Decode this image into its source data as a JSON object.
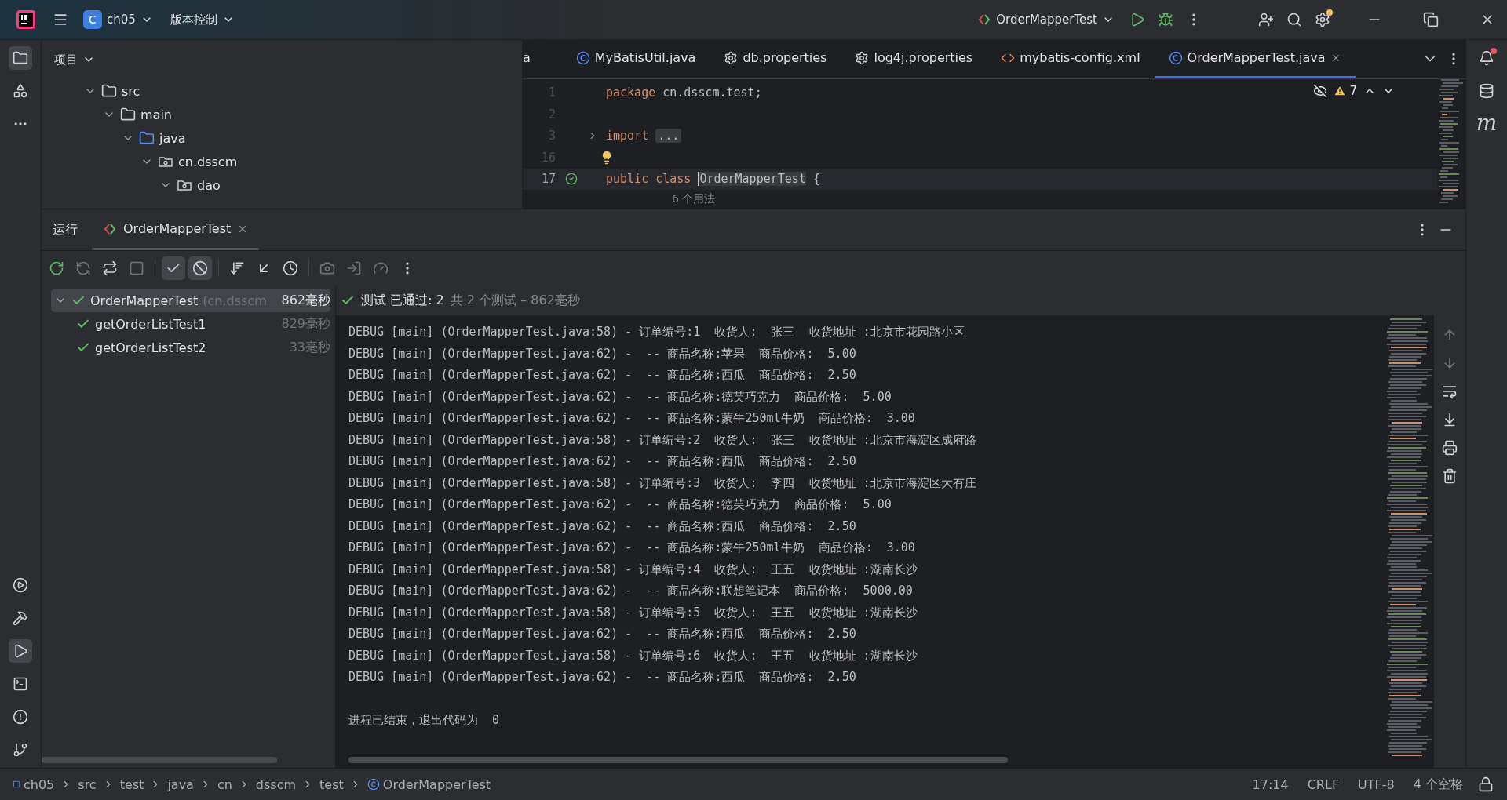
{
  "title_bar": {
    "project": "ch05",
    "project_badge": "C",
    "vcs": "版本控制",
    "run_config": "OrderMapperTest",
    "settings_badge": true
  },
  "project_panel": {
    "title": "项目",
    "tree": [
      {
        "label": "src",
        "kind": "folder",
        "expanded": true,
        "children": [
          {
            "label": "main",
            "kind": "folder",
            "expanded": true,
            "children": [
              {
                "label": "java",
                "kind": "source",
                "expanded": true,
                "children": [
                  {
                    "label": "cn.dsscm",
                    "kind": "package",
                    "expanded": true,
                    "children": [
                      {
                        "label": "dao",
                        "kind": "package",
                        "expanded": true
                      }
                    ]
                  }
                ]
              }
            ]
          }
        ]
      }
    ]
  },
  "editor": {
    "tabs": [
      {
        "label": "a",
        "kind": "cut",
        "selected": false
      },
      {
        "label": "MyBatisUtil.java",
        "kind": "class",
        "selected": false
      },
      {
        "label": "db.properties",
        "kind": "config",
        "selected": false
      },
      {
        "label": "log4j.properties",
        "kind": "config",
        "selected": false
      },
      {
        "label": "mybatis-config.xml",
        "kind": "xml",
        "selected": false
      },
      {
        "label": "OrderMapperTest.java",
        "kind": "class",
        "selected": true
      }
    ],
    "warnings": "7",
    "lines": [
      {
        "number": "1",
        "segments": [
          {
            "kind": "keyword",
            "text": "package"
          },
          {
            "kind": "plain",
            "text": "cn.dsscm.test;"
          }
        ]
      },
      {
        "number": "2"
      },
      {
        "number": "3",
        "folded": true,
        "segments": [
          {
            "kind": "keyword",
            "text": "import"
          },
          {
            "kind": "fold",
            "text": "..."
          }
        ]
      },
      {
        "number": "16",
        "bulb": true
      },
      {
        "number": "17",
        "current": true,
        "run": true,
        "segments": [
          {
            "kind": "keyword",
            "text": "public class"
          },
          {
            "kind": "highlight",
            "text": "OrderMapperTest"
          },
          {
            "kind": "plain",
            "text": "{"
          }
        ],
        "hint": "6 个用法"
      }
    ]
  },
  "run_panel": {
    "label": "运行",
    "tab": "OrderMapperTest",
    "show_passed": {
      "on": true
    },
    "show_ignored": {
      "on": true
    },
    "tests": [
      {
        "name": "OrderMapperTest",
        "package": "(cn.dsscm",
        "time": "862毫秒",
        "passed": true,
        "selected": true,
        "expanded": true,
        "children": [
          {
            "name": "getOrderListTest1",
            "time": "829毫秒",
            "passed": true,
            "selected": false
          },
          {
            "name": "getOrderListTest2",
            "time": "33毫秒",
            "passed": true,
            "selected": false
          }
        ]
      }
    ],
    "status": {
      "passed": true,
      "text": "测试 已通过: 2",
      "summary": "共 2 个测试 – 862毫秒"
    },
    "log": [
      "DEBUG [main] (OrderMapperTest.java:58) - 订单编号:1  收货人:  张三  收货地址 :北京市花园路小区",
      "DEBUG [main] (OrderMapperTest.java:62) -  -- 商品名称:苹果  商品价格:  5.00",
      "DEBUG [main] (OrderMapperTest.java:62) -  -- 商品名称:西瓜  商品价格:  2.50",
      "DEBUG [main] (OrderMapperTest.java:62) -  -- 商品名称:德芙巧克力  商品价格:  5.00",
      "DEBUG [main] (OrderMapperTest.java:62) -  -- 商品名称:蒙牛250ml牛奶  商品价格:  3.00",
      "DEBUG [main] (OrderMapperTest.java:58) - 订单编号:2  收货人:  张三  收货地址 :北京市海淀区成府路",
      "DEBUG [main] (OrderMapperTest.java:62) -  -- 商品名称:西瓜  商品价格:  2.50",
      "DEBUG [main] (OrderMapperTest.java:58) - 订单编号:3  收货人:  李四  收货地址 :北京市海淀区大有庄",
      "DEBUG [main] (OrderMapperTest.java:62) -  -- 商品名称:德芙巧克力  商品价格:  5.00",
      "DEBUG [main] (OrderMapperTest.java:62) -  -- 商品名称:西瓜  商品价格:  2.50",
      "DEBUG [main] (OrderMapperTest.java:62) -  -- 商品名称:蒙牛250ml牛奶  商品价格:  3.00",
      "DEBUG [main] (OrderMapperTest.java:58) - 订单编号:4  收货人:  王五  收货地址 :湖南长沙",
      "DEBUG [main] (OrderMapperTest.java:62) -  -- 商品名称:联想笔记本  商品价格:  5000.00",
      "DEBUG [main] (OrderMapperTest.java:58) - 订单编号:5  收货人:  王五  收货地址 :湖南长沙",
      "DEBUG [main] (OrderMapperTest.java:62) -  -- 商品名称:西瓜  商品价格:  2.50",
      "DEBUG [main] (OrderMapperTest.java:58) - 订单编号:6  收货人:  王五  收货地址 :湖南长沙",
      "DEBUG [main] (OrderMapperTest.java:62) -  -- 商品名称:西瓜  商品价格:  2.50"
    ],
    "exit_message": "进程已结束，退出代码为  0"
  },
  "right_strip": {
    "maven": "m",
    "notification_badge": true
  },
  "status_bar": {
    "breadcrumbs": [
      {
        "label": "ch05",
        "kind": "module"
      },
      {
        "label": "src",
        "kind": "dir"
      },
      {
        "label": "test",
        "kind": "dir"
      },
      {
        "label": "java",
        "kind": "dir"
      },
      {
        "label": "cn",
        "kind": "dir"
      },
      {
        "label": "dsscm",
        "kind": "dir"
      },
      {
        "label": "test",
        "kind": "dir"
      },
      {
        "label": "OrderMapperTest",
        "kind": "class"
      }
    ],
    "position": "17:14",
    "line_ending": "CRLF",
    "encoding": "UTF-8",
    "indent": "4 个空格"
  }
}
